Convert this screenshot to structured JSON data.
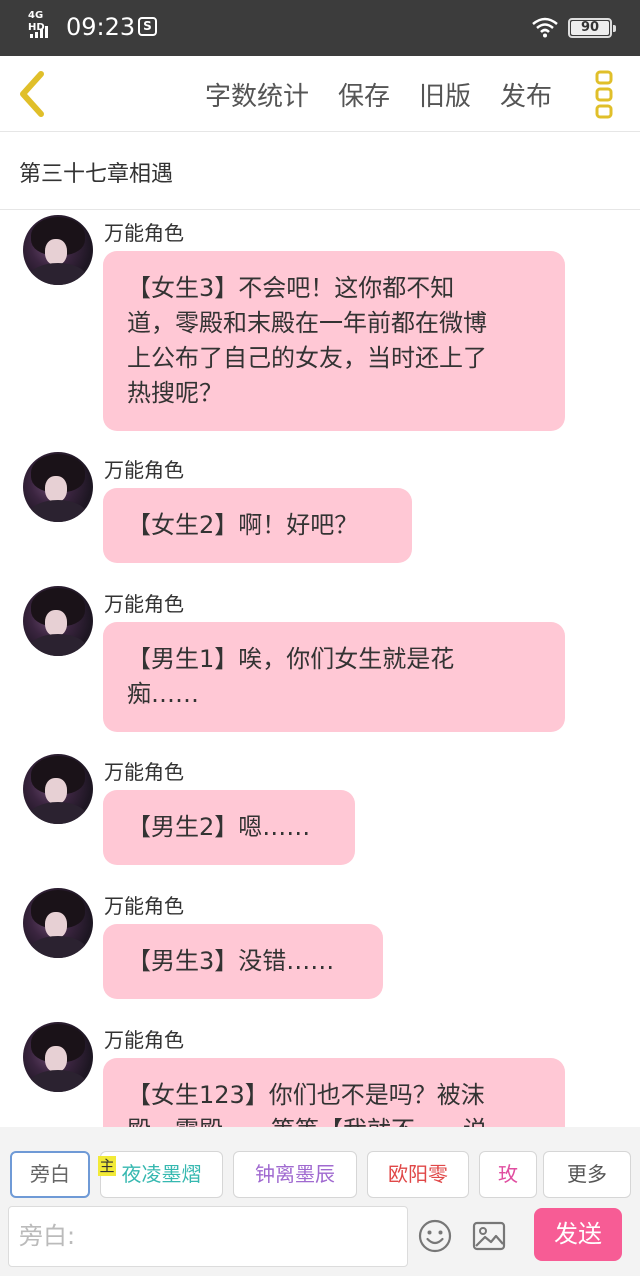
{
  "status_bar": {
    "network": "4G HD",
    "time": "09:23",
    "message_icon": "S",
    "battery": "90"
  },
  "toolbar": {
    "back_icon": "chevron-left-icon",
    "word_count": "字数统计",
    "save": "保存",
    "old_version": "旧版",
    "publish": "发布",
    "menu_icon": "three-dots-vertical-icon",
    "accent_color": "#e0bf2a"
  },
  "chapter": {
    "title": "第三十七章相遇"
  },
  "messages": [
    {
      "sender": "万能角色",
      "lines": [
        "【女生3】不会吧！这你都不知",
        "道，零殿和末殿在一年前都在微博",
        "上公布了自己的女友，当时还上了",
        "热搜呢？"
      ]
    },
    {
      "sender": "万能角色",
      "lines": [
        "【女生2】啊！好吧？"
      ]
    },
    {
      "sender": "万能角色",
      "lines": [
        "【男生1】唉，你们女生就是花",
        "痴……"
      ]
    },
    {
      "sender": "万能角色",
      "lines": [
        "【男生2】嗯……"
      ]
    },
    {
      "sender": "万能角色",
      "lines": [
        "【男生3】没错……"
      ]
    },
    {
      "sender": "万能角色",
      "lines": [
        "【女生123】你们也不是吗？被沫",
        "殿、零殿……等等【我就不……说"
      ]
    }
  ],
  "bubble_color": "#ffc8d5",
  "characters": {
    "items": [
      {
        "label": "旁白",
        "color": "#666666"
      },
      {
        "label": "夜凌墨熠",
        "color": "#36b8b0",
        "tag": "主"
      },
      {
        "label": "钟离墨辰",
        "color": "#a06ad0"
      },
      {
        "label": "欧阳零",
        "color": "#e04848"
      },
      {
        "label": "玫",
        "color": "#e04ea0"
      },
      {
        "label": "更多",
        "color": "#555555"
      }
    ]
  },
  "input": {
    "placeholder": "旁白:",
    "emoji_icon": "smiley-face-icon",
    "image_icon": "image-icon",
    "send": "发送",
    "send_color": "#f75c95"
  }
}
